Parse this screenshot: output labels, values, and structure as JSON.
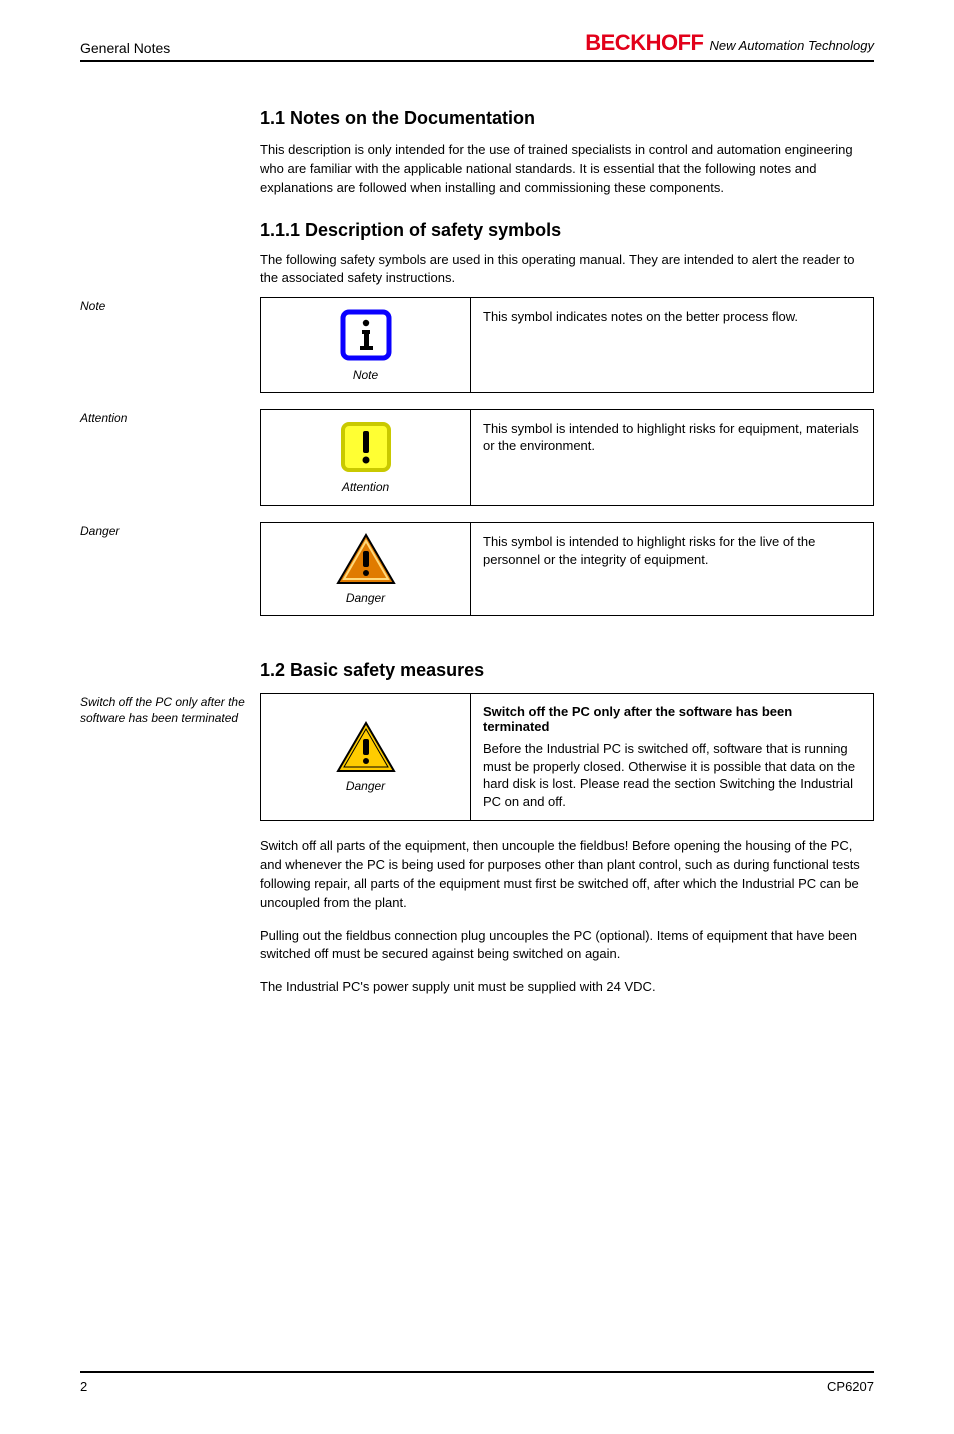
{
  "header": {
    "section_ref": "General Notes",
    "logo_text": "BECKHOFF",
    "logo_tagline": "New Automation Technology"
  },
  "section": {
    "number_title": "1.1   Notes on the Documentation",
    "intro": "This description is only intended for the use of trained specialists in control and automation engineering who are familiar with the applicable national standards. It is essential that the following notes and explanations are followed when installing and commissioning these components."
  },
  "symbols": {
    "heading": "1.1.1 Description of safety symbols",
    "intro": "The following safety symbols are used in this operating manual. They are intended to alert the reader to the associated safety instructions.",
    "margin_labels": {
      "note": "Note",
      "attention": "Attention",
      "danger": "Danger"
    },
    "note": {
      "icon_name": "info-icon",
      "caption": "Note",
      "body": "This symbol indicates notes on the better process flow."
    },
    "attention": {
      "icon_name": "exclamation-square-icon",
      "caption": "Attention",
      "body": "This symbol is intended to highlight risks for equipment, materials or the environment."
    },
    "danger": {
      "icon_name": "warning-triangle-icon",
      "caption": "Danger",
      "body": "This symbol is intended to highlight risks for the live of the personnel or the integrity of equipment."
    }
  },
  "basic_safety": {
    "heading": "1.2   Basic safety measures",
    "margin_label": "Switch off the PC only after the software has been terminated",
    "callout": {
      "title": "Switch off the PC only after the software has been terminated",
      "body": "Before the Industrial PC is switched off, software that is running must be properly closed. Otherwise it is possible that data on the hard disk is lost. Please read the section Switching the Industrial PC on and off."
    },
    "para1": "Switch off all parts of the equipment, then uncouple the fieldbus! Before opening the housing of the PC, and whenever the PC is being used for purposes other than plant control, such as during functional tests following repair, all parts of the equipment must first be switched off, after which the Industrial PC can be uncoupled from the plant.",
    "para2": "Pulling out the fieldbus connection plug uncouples the PC (optional). Items of equipment that have been switched off must be secured against being switched on again.",
    "para3": "The Industrial PC's power supply unit must be supplied with 24 VDC."
  },
  "footer": {
    "left": "2",
    "right": "CP6207"
  }
}
